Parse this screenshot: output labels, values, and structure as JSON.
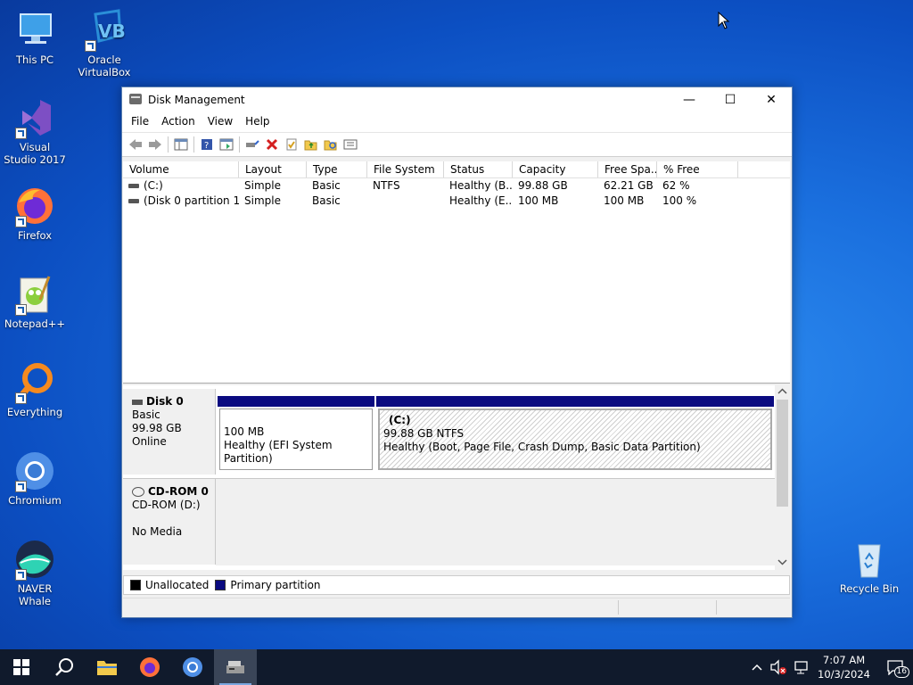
{
  "desktop": {
    "icons": [
      {
        "label": "This PC"
      },
      {
        "label": "Oracle VirtualBox"
      },
      {
        "label": "Visual Studio 2017"
      },
      {
        "label": "Firefox"
      },
      {
        "label": "Notepad++"
      },
      {
        "label": "Everything"
      },
      {
        "label": "Chromium"
      },
      {
        "label": "NAVER Whale"
      },
      {
        "label": "Recycle Bin"
      }
    ]
  },
  "window": {
    "title": "Disk Management",
    "controls": {
      "minimize": "—",
      "maximize": "☐",
      "close": "✕"
    },
    "menu": [
      "File",
      "Action",
      "View",
      "Help"
    ]
  },
  "volume_table": {
    "columns": [
      "Volume",
      "Layout",
      "Type",
      "File System",
      "Status",
      "Capacity",
      "Free Spa...",
      "% Free"
    ],
    "rows": [
      [
        "(C:)",
        "Simple",
        "Basic",
        "NTFS",
        "Healthy (B...",
        "99.88 GB",
        "62.21 GB",
        "62 %"
      ],
      [
        "(Disk 0 partition 1)",
        "Simple",
        "Basic",
        "",
        "Healthy (E...",
        "100 MB",
        "100 MB",
        "100 %"
      ]
    ]
  },
  "disks": {
    "disk0": {
      "name": "Disk 0",
      "type": "Basic",
      "size": "99.98 GB",
      "state": "Online",
      "partitions": [
        {
          "title": "",
          "size": "100 MB",
          "status": "Healthy (EFI System Partition)"
        },
        {
          "title": "(C:)",
          "size": "99.88 GB NTFS",
          "status": "Healthy (Boot, Page File, Crash Dump, Basic Data Partition)"
        }
      ]
    },
    "cdrom0": {
      "name": "CD-ROM 0",
      "type": "CD-ROM (D:)",
      "state": "No Media"
    }
  },
  "legend": {
    "unallocated": "Unallocated",
    "primary": "Primary partition",
    "colors": {
      "unallocated": "#000000",
      "primary": "#0a0a80"
    }
  },
  "taskbar": {
    "time": "7:07 AM",
    "date": "10/3/2024",
    "notifications": "16"
  }
}
